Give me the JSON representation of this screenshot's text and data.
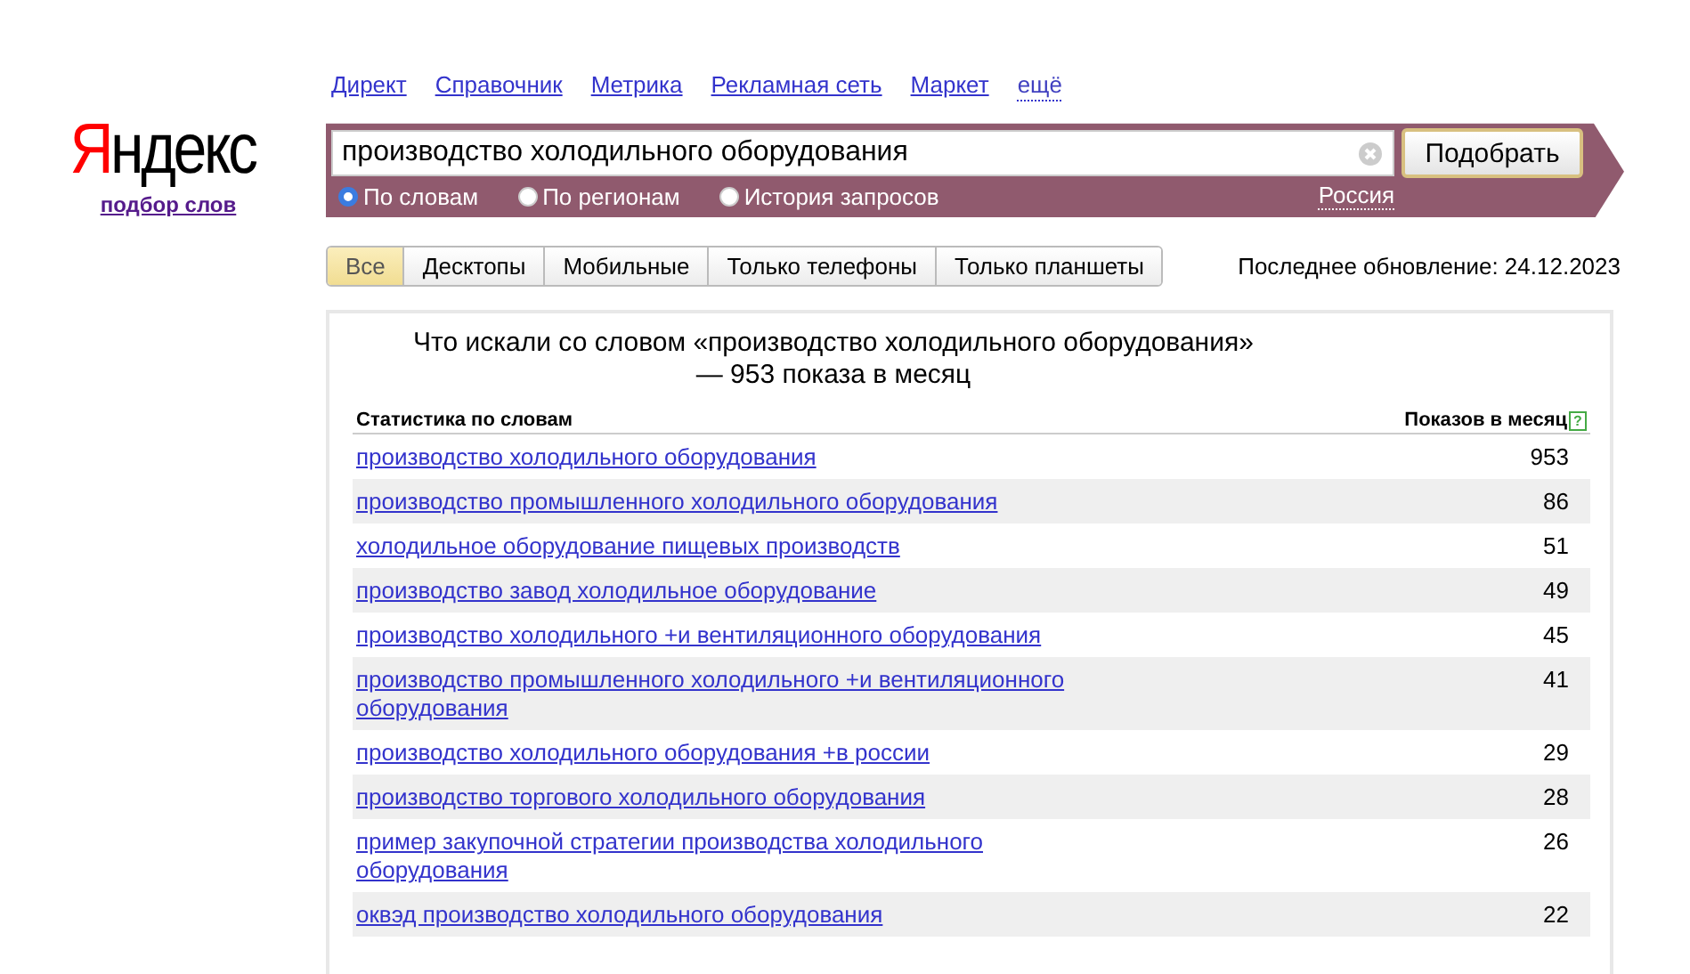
{
  "logo": {
    "text": "Яндекс",
    "subtitle": "подбор слов"
  },
  "nav": [
    {
      "label": "Директ",
      "kind": "link"
    },
    {
      "label": "Справочник",
      "kind": "link"
    },
    {
      "label": "Метрика",
      "kind": "link"
    },
    {
      "label": "Рекламная сеть",
      "kind": "link"
    },
    {
      "label": "Маркет",
      "kind": "link"
    },
    {
      "label": "ещё",
      "kind": "more"
    }
  ],
  "search": {
    "value": "производство холодильного оборудования",
    "button": "Подобрать",
    "region": "Россия"
  },
  "modes": [
    {
      "label": "По словам",
      "selected": true
    },
    {
      "label": "По регионам",
      "selected": false
    },
    {
      "label": "История запросов",
      "selected": false
    }
  ],
  "tabs": [
    {
      "label": "Все",
      "selected": true
    },
    {
      "label": "Десктопы",
      "selected": false
    },
    {
      "label": "Мобильные",
      "selected": false
    },
    {
      "label": "Только телефоны",
      "selected": false
    },
    {
      "label": "Только планшеты",
      "selected": false
    }
  ],
  "last_update": "Последнее обновление: 24.12.2023",
  "results": {
    "heading": "Что искали со словом «производство холодильного оборудования» — 953 показа в месяц",
    "columns": [
      "Статистика по словам",
      "Показов в месяц"
    ],
    "help": "?",
    "rows": [
      {
        "phrase": "производство холодильного оборудования",
        "count": "953"
      },
      {
        "phrase": "производство промышленного холодильного оборудования",
        "count": "86"
      },
      {
        "phrase": "холодильное оборудование пищевых производств",
        "count": "51"
      },
      {
        "phrase": "производство завод холодильное оборудование",
        "count": "49"
      },
      {
        "phrase": "производство холодильного +и вентиляционного оборудования",
        "count": "45"
      },
      {
        "phrase": "производство промышленного холодильного +и вентиляционного оборудования",
        "count": "41"
      },
      {
        "phrase": "производство холодильного оборудования +в россии",
        "count": "29"
      },
      {
        "phrase": "производство торгового холодильного оборудования",
        "count": "28"
      },
      {
        "phrase": "пример закупочной стратегии производства холодильного оборудования",
        "count": "26"
      },
      {
        "phrase": "оквэд производство холодильного оборудования",
        "count": "22"
      }
    ]
  }
}
